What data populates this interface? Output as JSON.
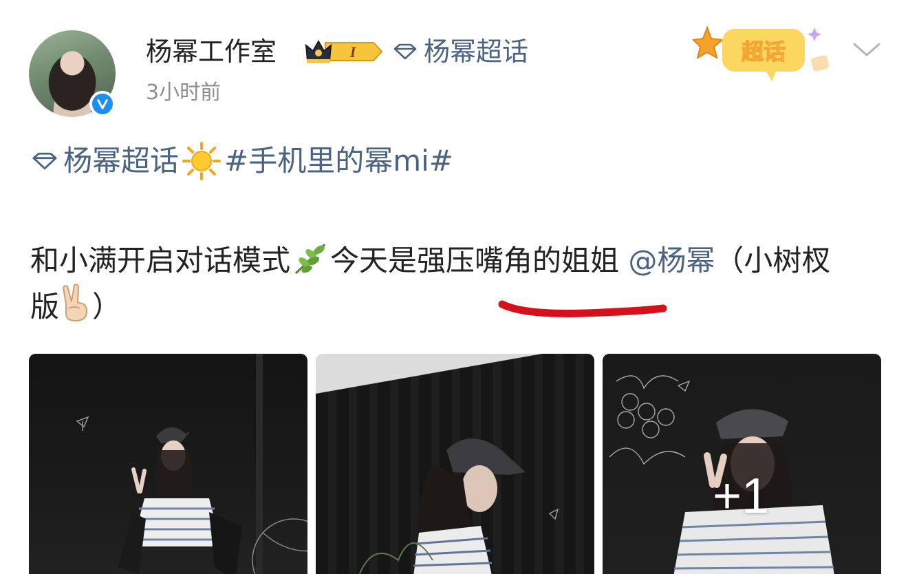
{
  "post": {
    "username": "杨幂工作室",
    "fan_badge_level": "I",
    "supertopic_link": "杨幂超话",
    "timestamp": "3小时前",
    "chaohua_badge": "超话"
  },
  "content": {
    "topic": "杨幂超话",
    "hashtag": "#手机里的幂mi#",
    "text_before_emoji": "和小满开启对话模式",
    "text_after_emoji": "今天是强压嘴角的姐姐",
    "mention": "@杨幂",
    "text_end": "（小树杈版",
    "text_close": "）"
  },
  "images": {
    "count": 3,
    "more_label": "+1"
  },
  "colors": {
    "link": "#4a6382",
    "text": "#222222",
    "muted": "#8e8e8e",
    "verified": "#1f8ef1",
    "annotation": "#d5121c"
  },
  "icons": {
    "verified": "verified-check-icon",
    "crown": "crown-icon",
    "diamond": "supertopic-diamond-icon",
    "chevron": "chevron-down-icon",
    "sun": "sun-emoji",
    "leaf": "herb-emoji",
    "victory": "victory-hand-emoji"
  }
}
